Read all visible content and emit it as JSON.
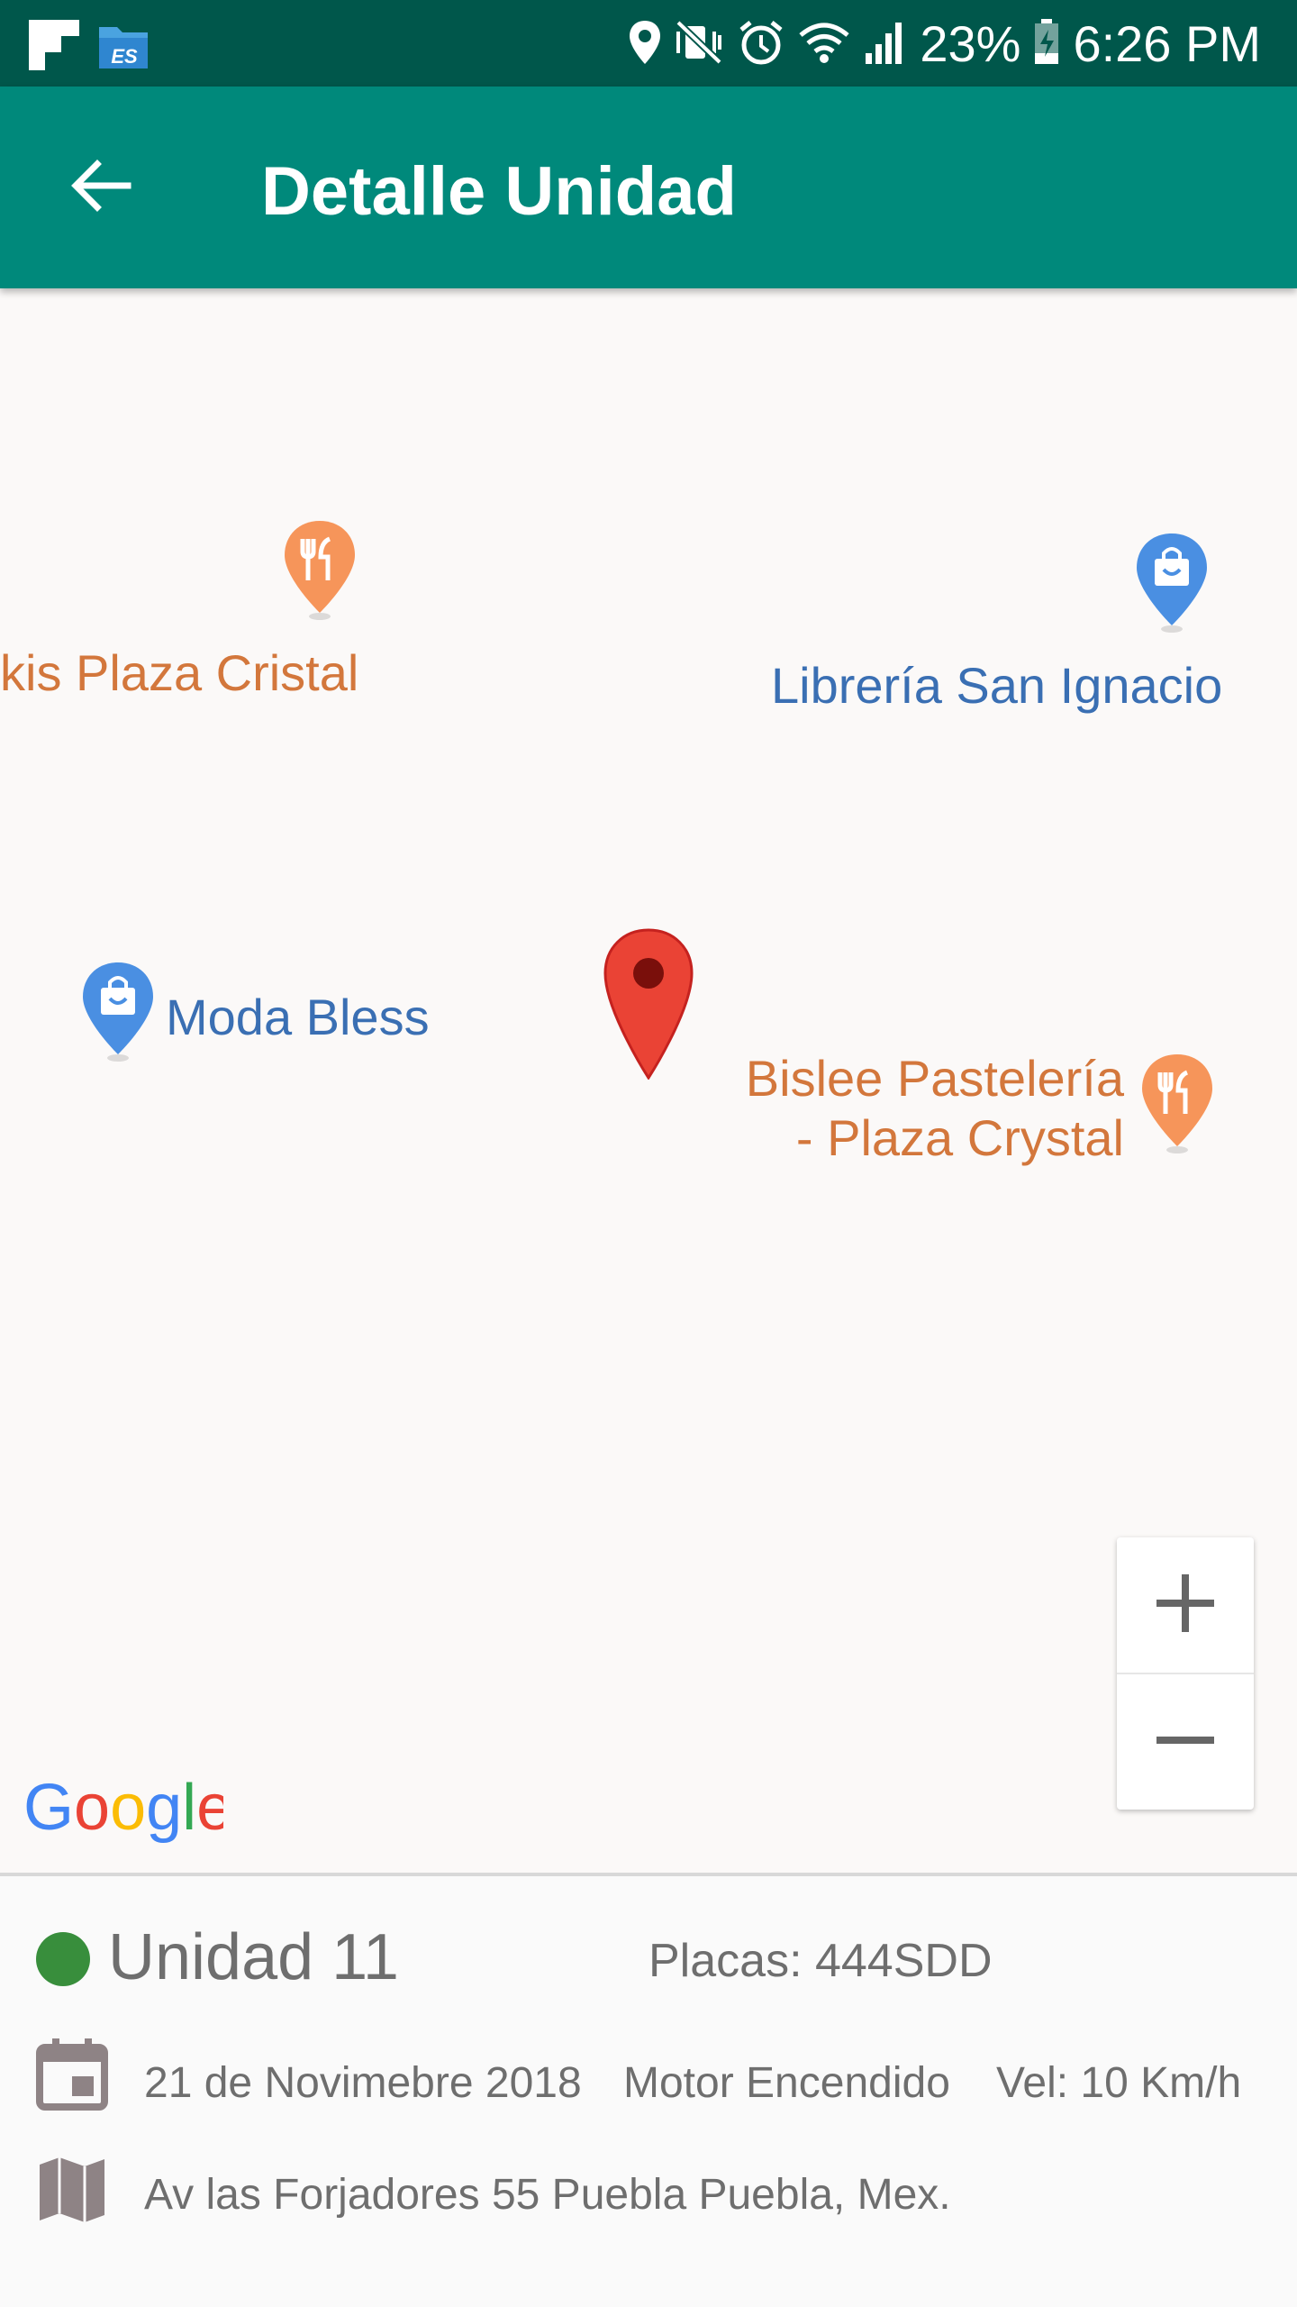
{
  "status_bar": {
    "battery": "23%",
    "time": "6:26 PM",
    "icons": [
      "flipboard-icon",
      "es-file-explorer-icon",
      "location-icon",
      "vibrate-mute-icon",
      "alarm-icon",
      "wifi-icon",
      "signal-icon",
      "battery-charging-icon"
    ]
  },
  "app_bar": {
    "title": "Detalle Unidad",
    "back_icon": "arrow-back-icon"
  },
  "map": {
    "pois": [
      {
        "label": "kis Plaza Cristal",
        "category": "restaurant"
      },
      {
        "label": "Librería San Ignacio",
        "category": "shopping"
      },
      {
        "label": "Moda Bless",
        "category": "shopping"
      },
      {
        "label": "Bislee Pastelería",
        "label_line2": "- Plaza Crystal",
        "category": "restaurant"
      }
    ],
    "zoom_in": "+",
    "zoom_out": "−",
    "logo": "Google",
    "colors": {
      "food": "#d3773c",
      "shop": "#3a6fb3",
      "marker": "#ea4335"
    }
  },
  "unit": {
    "name": "Unidad 11",
    "status_color": "#388e3c",
    "plates": "Placas: 444SDD",
    "date": "21 de Novimebre 2018",
    "engine": "Motor Encendido",
    "speed": "Vel: 10 Km/h",
    "address": "Av las Forjadores 55 Puebla Puebla, Mex."
  }
}
